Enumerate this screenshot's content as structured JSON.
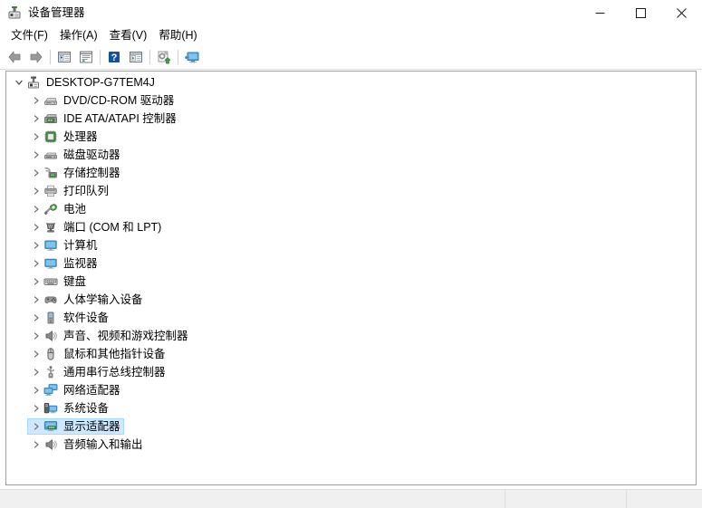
{
  "window": {
    "title": "设备管理器",
    "title_icon": "device-manager-icon",
    "minimize_label": "–",
    "maximize_label": "□",
    "close_label": "✕"
  },
  "menubar": {
    "items": [
      {
        "label": "文件(F)",
        "name": "menu-file"
      },
      {
        "label": "操作(A)",
        "name": "menu-action"
      },
      {
        "label": "查看(V)",
        "name": "menu-view"
      },
      {
        "label": "帮助(H)",
        "name": "menu-help"
      }
    ]
  },
  "toolbar": {
    "items": [
      {
        "name": "back-arrow-icon",
        "tooltip": "后退"
      },
      {
        "name": "forward-arrow-icon",
        "tooltip": "前进"
      },
      {
        "name": "separator",
        "tooltip": ""
      },
      {
        "name": "show-hide-console-tree-icon",
        "tooltip": "显示/隐藏控制台树"
      },
      {
        "name": "properties-icon",
        "tooltip": "属性"
      },
      {
        "name": "separator",
        "tooltip": ""
      },
      {
        "name": "help-icon",
        "tooltip": "帮助"
      },
      {
        "name": "scan-for-hardware-changes-icon",
        "tooltip": "扫描检测硬件改动"
      },
      {
        "name": "separator",
        "tooltip": ""
      },
      {
        "name": "update-driver-icon",
        "tooltip": "更新驱动程序"
      },
      {
        "name": "separator",
        "tooltip": ""
      },
      {
        "name": "display-device-icon",
        "tooltip": "显示设备"
      }
    ]
  },
  "tree": {
    "root": {
      "label": "DESKTOP-G7TEM4J",
      "icon": "computer-root-icon",
      "expanded": true,
      "chevron": "⌄"
    },
    "children": [
      {
        "label": "DVD/CD-ROM 驱动器",
        "icon": "dvd-drive-icon",
        "selected": false
      },
      {
        "label": "IDE ATA/ATAPI 控制器",
        "icon": "ide-controller-icon",
        "selected": false
      },
      {
        "label": "处理器",
        "icon": "processor-icon",
        "selected": false
      },
      {
        "label": "磁盘驱动器",
        "icon": "disk-drive-icon",
        "selected": false
      },
      {
        "label": "存储控制器",
        "icon": "storage-controller-icon",
        "selected": false
      },
      {
        "label": "打印队列",
        "icon": "print-queue-icon",
        "selected": false
      },
      {
        "label": "电池",
        "icon": "battery-icon",
        "selected": false
      },
      {
        "label": "端口 (COM 和 LPT)",
        "icon": "ports-icon",
        "selected": false
      },
      {
        "label": "计算机",
        "icon": "computer-icon",
        "selected": false
      },
      {
        "label": "监视器",
        "icon": "monitor-icon",
        "selected": false
      },
      {
        "label": "键盘",
        "icon": "keyboard-icon",
        "selected": false
      },
      {
        "label": "人体学输入设备",
        "icon": "hid-device-icon",
        "selected": false
      },
      {
        "label": "软件设备",
        "icon": "software-device-icon",
        "selected": false
      },
      {
        "label": "声音、视频和游戏控制器",
        "icon": "sound-video-game-icon",
        "selected": false
      },
      {
        "label": "鼠标和其他指针设备",
        "icon": "mouse-icon",
        "selected": false
      },
      {
        "label": "通用串行总线控制器",
        "icon": "usb-controller-icon",
        "selected": false
      },
      {
        "label": "网络适配器",
        "icon": "network-adapter-icon",
        "selected": false
      },
      {
        "label": "系统设备",
        "icon": "system-device-icon",
        "selected": false
      },
      {
        "label": "显示适配器",
        "icon": "display-adapter-icon",
        "selected": true
      },
      {
        "label": "音频输入和输出",
        "icon": "audio-io-icon",
        "selected": false
      }
    ],
    "collapsed_chevron": "›"
  },
  "statusbar": {
    "cells": [
      "",
      "",
      ""
    ]
  },
  "colors": {
    "selection_bg": "#cde8ff",
    "selection_border": "#a6d9ff",
    "panel_border": "#a0a0a0",
    "statusbar_bg": "#f0f0f0",
    "icon_green": "#3c9b3c",
    "icon_blue": "#3b9ad9",
    "icon_gray": "#8a8a8a"
  }
}
